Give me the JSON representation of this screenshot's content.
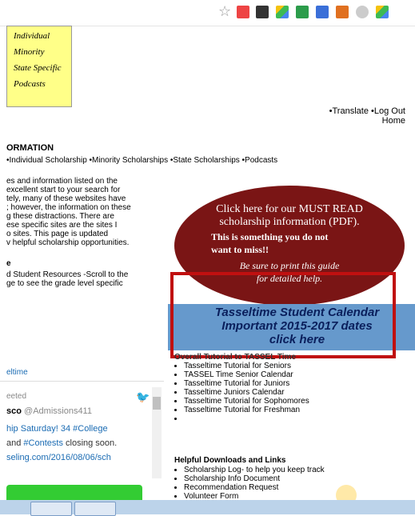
{
  "toolbar": {
    "icons": [
      "star-icon",
      "red-plus-icon",
      "film-icon",
      "drive-icon",
      "evernote-icon",
      "blue-square-icon",
      "office-icon",
      "clock-icon",
      "drive2-icon"
    ]
  },
  "sticky": {
    "items": [
      "Individual",
      "Minority",
      "State Specific",
      "Podcasts"
    ]
  },
  "toplinks": {
    "translate": "•Translate",
    "logout": "•Log Out",
    "home": "Home"
  },
  "heading": "ORMATION",
  "navlinks": "•Individual Scholarship  •Minority Scholarships  •State Scholarships  •Podcasts",
  "para": [
    "es and information listed on the",
    "excellent start to your search for",
    "tely, many of these websites have",
    "; however, the information on these",
    "g these distractions. There are",
    "ese specific sites are the sites I",
    "o sites. This page is updated",
    "v helpful scholarship opportunities."
  ],
  "subheading": "e",
  "para2": [
    "d Student Resources -Scroll to the",
    "ge to see the grade level specific"
  ],
  "oval": {
    "line1": "Click here for our MUST READ",
    "line1b": "scholarship information (PDF).",
    "line2": "This is something you do not",
    "line2b": "want to miss!!",
    "line3": "Be sure to print this guide",
    "line3b": "for detailed help."
  },
  "calendar": {
    "line1": "Tasseltime Student Calendar",
    "line2": "Important 2015-2017 dates",
    "line3": "click here"
  },
  "tutorials_heading": "Overall Tutorial to TASSEL Time",
  "tutorials": [
    "Tasseltime Tutorial for Seniors",
    "TASSEL Time Senior Calendar",
    "Tasseltime Tutorial for Juniors",
    "Tasseltime Juniors Calendar",
    "Tasseltime Tutorial for Sophomores",
    "Tasseltime Tutorial for Freshman",
    ""
  ],
  "help_heading": "Helpful Downloads and Links",
  "help": [
    "Scholarship Log- to help you keep track",
    "Scholarship Info Document",
    "Recommendation Request",
    "Volunteer Form"
  ],
  "twitter": {
    "link": "eltime",
    "retweeted": "eeted",
    "name": "sco",
    "handle": "@Admissions411",
    "line1_pre": "hip Saturday! 34 ",
    "line1_tag": "#College",
    "line2_pre": " and ",
    "line2_tag": "#Contests",
    "line2_post": " closing soon.",
    "line3": "seling.com/2016/08/06/sch"
  },
  "colors": {
    "oval": "#7a1515",
    "calendar": "#6699cc",
    "redbox": "#c01010",
    "link": "#1a6bb3"
  }
}
